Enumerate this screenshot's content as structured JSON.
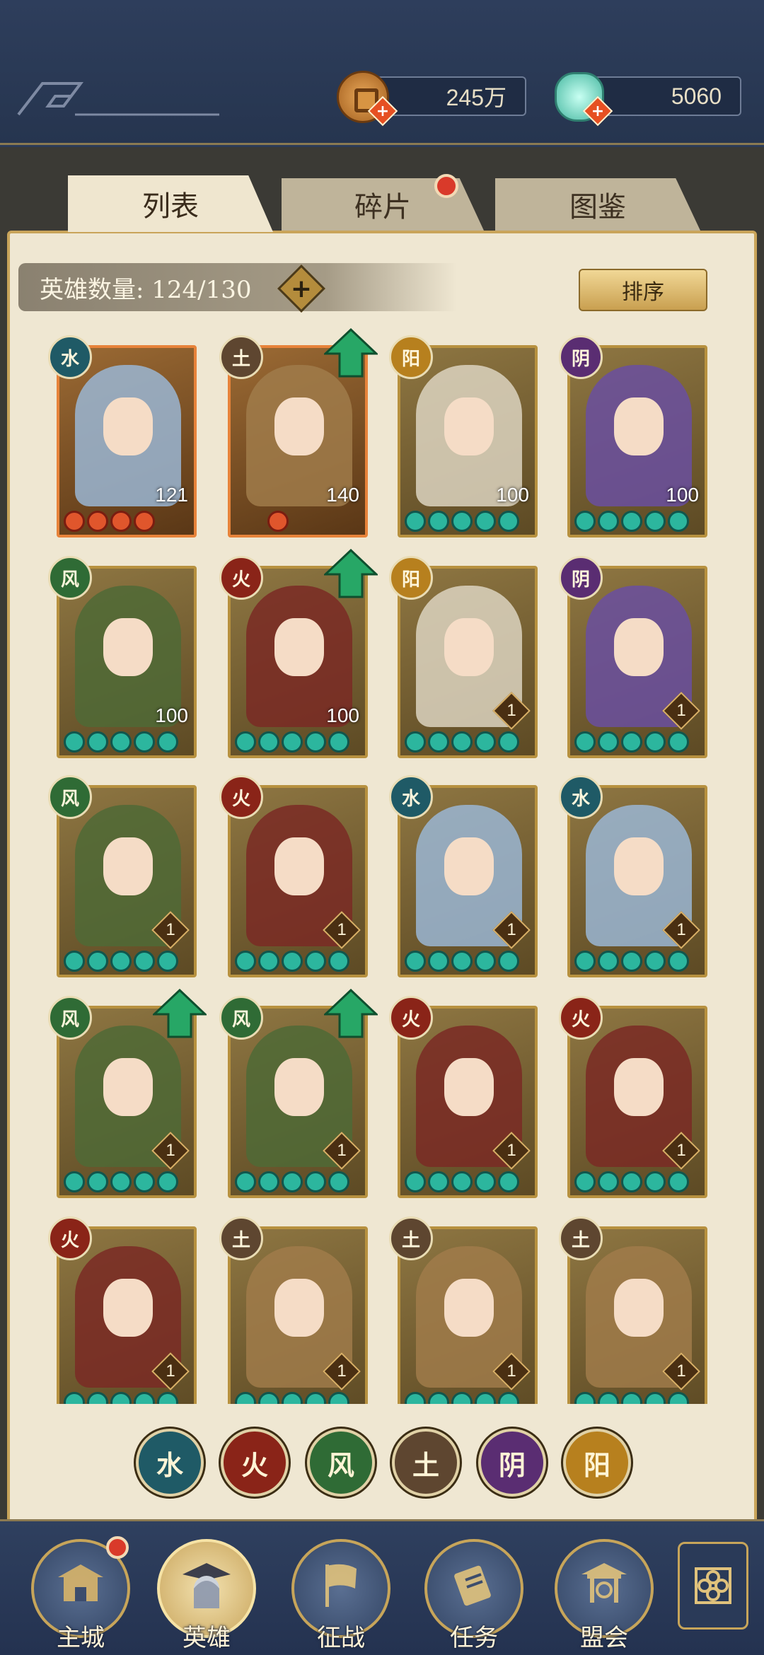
{
  "resources": {
    "copper": "245万",
    "jade": "5060"
  },
  "tabs": {
    "list": "列表",
    "fragments": "碎片",
    "atlas": "图鉴"
  },
  "hero_count": "英雄数量: 124/130",
  "sort_label": "排序",
  "elements": {
    "water": "水",
    "fire": "火",
    "wind": "风",
    "earth": "土",
    "yin": "阴",
    "yang": "阳"
  },
  "element_colors": {
    "water": "#1f5a66",
    "fire": "#8a2418",
    "wind": "#2f6b35",
    "earth": "#5e4630",
    "yin": "#5a2d72",
    "yang": "#b7801e"
  },
  "heroes": [
    {
      "element": "水",
      "level": "121",
      "stars": "red",
      "upgrade": false
    },
    {
      "element": "土",
      "level": "140",
      "stars": "red-one",
      "upgrade": true
    },
    {
      "element": "阳",
      "level": "100",
      "stars": "jade",
      "upgrade": false
    },
    {
      "element": "阴",
      "level": "100",
      "stars": "jade",
      "upgrade": false
    },
    {
      "element": "风",
      "level": "100",
      "stars": "jade",
      "upgrade": false
    },
    {
      "element": "火",
      "level": "100",
      "stars": "jade",
      "upgrade": true
    },
    {
      "element": "阳",
      "level": "1",
      "stars": "jade",
      "upgrade": false
    },
    {
      "element": "阴",
      "level": "1",
      "stars": "jade",
      "upgrade": false
    },
    {
      "element": "风",
      "level": "1",
      "stars": "jade",
      "upgrade": false
    },
    {
      "element": "火",
      "level": "1",
      "stars": "jade",
      "upgrade": false
    },
    {
      "element": "水",
      "level": "1",
      "stars": "jade",
      "upgrade": false
    },
    {
      "element": "水",
      "level": "1",
      "stars": "jade",
      "upgrade": false
    },
    {
      "element": "风",
      "level": "1",
      "stars": "jade",
      "upgrade": true
    },
    {
      "element": "风",
      "level": "1",
      "stars": "jade",
      "upgrade": true
    },
    {
      "element": "火",
      "level": "1",
      "stars": "jade",
      "upgrade": false
    },
    {
      "element": "火",
      "level": "1",
      "stars": "jade",
      "upgrade": false
    },
    {
      "element": "火",
      "level": "1",
      "stars": "jade",
      "upgrade": false
    },
    {
      "element": "土",
      "level": "1",
      "stars": "jade",
      "upgrade": false
    },
    {
      "element": "土",
      "level": "1",
      "stars": "jade",
      "upgrade": false
    },
    {
      "element": "土",
      "level": "1",
      "stars": "jade",
      "upgrade": false
    }
  ],
  "nav": {
    "city": "主城",
    "hero": "英雄",
    "battle": "征战",
    "quest": "任务",
    "alliance": "盟会"
  }
}
